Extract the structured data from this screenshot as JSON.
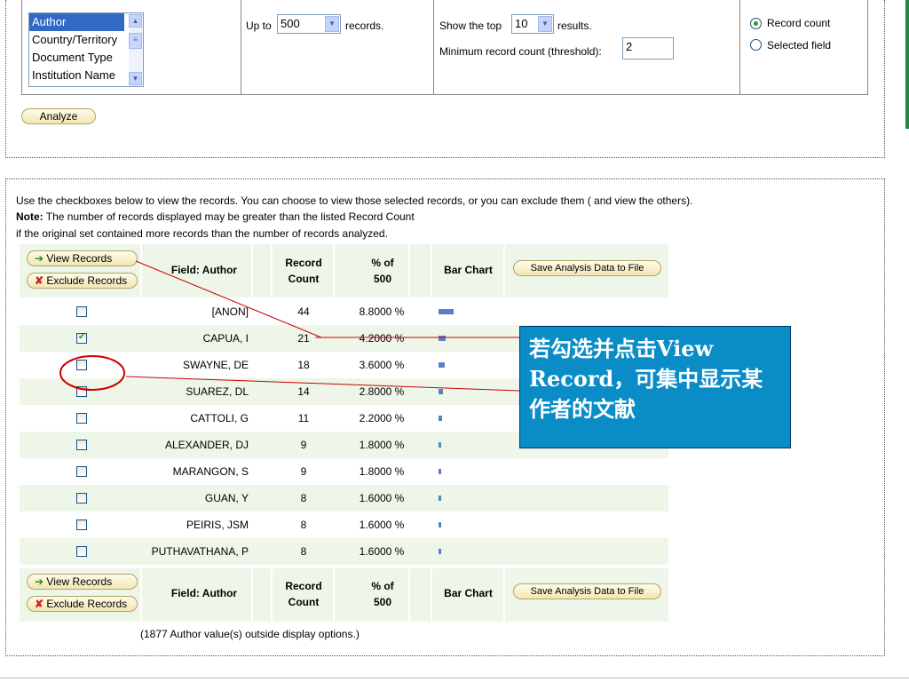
{
  "criteria": {
    "field_list": [
      "Author",
      "Country/Territory",
      "Document Type",
      "Institution Name"
    ],
    "selected_field": "Author",
    "up_to_label": "Up to",
    "records_value": "500",
    "records_suffix": "records.",
    "show_top_label": "Show the top",
    "show_top_value": "10",
    "results_suffix": "results.",
    "threshold_label": "Minimum record count (threshold):",
    "threshold_value": "2",
    "sort_options": [
      "Record count",
      "Selected field"
    ],
    "sort_selected": "Record count"
  },
  "analyze_button": "Analyze",
  "instructions": {
    "line1": "Use the checkboxes below to view the records. You can choose to view those selected records, or you can exclude them ( and view the others).",
    "note_label": "Note:",
    "line2": " The number of records displayed may be greater than the listed Record Count",
    "line3": "if the original set contained more records than the number of records analyzed."
  },
  "table": {
    "view_records": "View Records",
    "exclude_records": "Exclude Records",
    "col_field": "Field: Author",
    "col_count_1": "Record",
    "col_count_2": "Count",
    "col_pct_1": "% of",
    "col_pct_2": "500",
    "col_bar": "Bar Chart",
    "save_button": "Save Analysis Data to File",
    "rows": [
      {
        "author": "[ANON]",
        "count": "44",
        "percent": "8.8000 %",
        "checked": false
      },
      {
        "author": "CAPUA, I",
        "count": "21",
        "percent": "4.2000 %",
        "checked": true
      },
      {
        "author": "SWAYNE, DE",
        "count": "18",
        "percent": "3.6000 %",
        "checked": false
      },
      {
        "author": "SUAREZ, DL",
        "count": "14",
        "percent": "2.8000 %",
        "checked": false
      },
      {
        "author": "CATTOLI, G",
        "count": "11",
        "percent": "2.2000 %",
        "checked": false
      },
      {
        "author": "ALEXANDER, DJ",
        "count": "9",
        "percent": "1.8000 %",
        "checked": false
      },
      {
        "author": "MARANGON, S",
        "count": "9",
        "percent": "1.8000 %",
        "checked": false
      },
      {
        "author": "GUAN, Y",
        "count": "8",
        "percent": "1.6000 %",
        "checked": false
      },
      {
        "author": "PEIRIS, JSM",
        "count": "8",
        "percent": "1.6000 %",
        "checked": false
      },
      {
        "author": "PUTHAVATHANA, P",
        "count": "8",
        "percent": "1.6000 %",
        "checked": false
      }
    ],
    "footer_note": "(1877 Author value(s) outside display options.)"
  },
  "chart_data": {
    "type": "bar",
    "categories": [
      "[ANON]",
      "CAPUA, I",
      "SWAYNE, DE",
      "SUAREZ, DL",
      "CATTOLI, G",
      "ALEXANDER, DJ",
      "MARANGON, S",
      "GUAN, Y",
      "PEIRIS, JSM",
      "PUTHAVATHANA, P"
    ],
    "values": [
      44,
      21,
      18,
      14,
      11,
      9,
      9,
      8,
      8,
      8
    ]
  },
  "callout": {
    "text": "若勾选并点击View Record，可集中显示某作者的文献"
  },
  "colors": {
    "bar": "#5b7ecb",
    "callout_bg": "#0a8cc7",
    "annotation_red": "#cc0000",
    "row_tint": "#eef6ea"
  }
}
